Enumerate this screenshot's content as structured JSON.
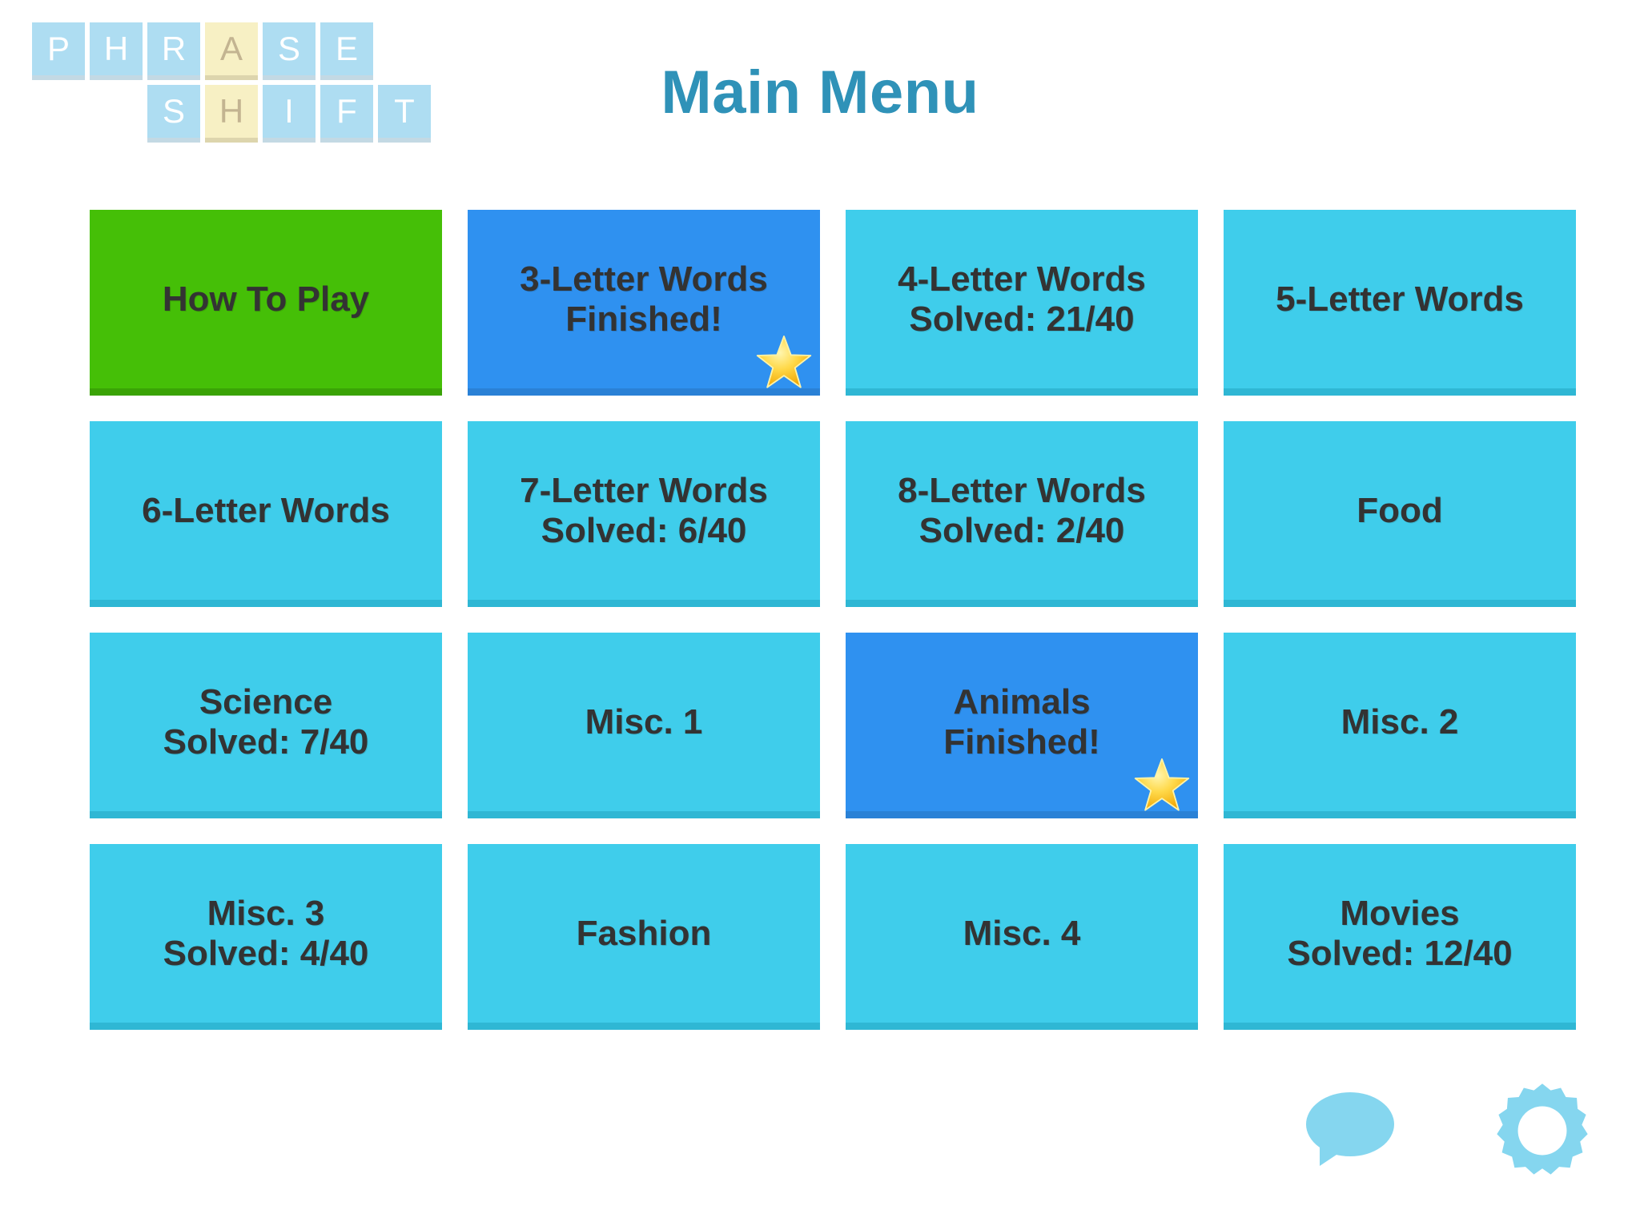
{
  "logo": {
    "name": "Phrase Shift",
    "row1": [
      {
        "letter": "P",
        "color": "blue"
      },
      {
        "letter": "H",
        "color": "blue"
      },
      {
        "letter": "R",
        "color": "blue"
      },
      {
        "letter": "A",
        "color": "yellow"
      },
      {
        "letter": "S",
        "color": "blue"
      },
      {
        "letter": "E",
        "color": "blue"
      }
    ],
    "row2": [
      {
        "letter": "S",
        "color": "blue"
      },
      {
        "letter": "H",
        "color": "yellow"
      },
      {
        "letter": "I",
        "color": "blue"
      },
      {
        "letter": "F",
        "color": "blue"
      },
      {
        "letter": "T",
        "color": "blue"
      }
    ]
  },
  "header": {
    "title": "Main Menu"
  },
  "colors": {
    "title": "#2f92b8",
    "tile_cyan": "#3fcdeb",
    "tile_cyan_shadow": "#2fb7d4",
    "tile_green": "#45bf07",
    "tile_green_shadow": "#3aa306",
    "tile_finished": "#2f91f0",
    "tile_finished_shadow": "#2a81d6",
    "tile_text": "#333333",
    "logo_blue": "#aeddf2",
    "logo_yellow": "#f7f0c4",
    "logo_yellow_text": "#c3b491",
    "bottom_icons": "#85d6ef",
    "star": "#ffcc22"
  },
  "tiles": [
    {
      "name": "how-to-play",
      "label": "How To Play",
      "sub": "",
      "style": "green",
      "star": false
    },
    {
      "name": "3-letter-words",
      "label": "3-Letter Words",
      "sub": "Finished!",
      "style": "done",
      "star": true
    },
    {
      "name": "4-letter-words",
      "label": "4-Letter Words",
      "sub": "Solved: 21/40",
      "style": "cyan",
      "star": false
    },
    {
      "name": "5-letter-words",
      "label": "5-Letter Words",
      "sub": "",
      "style": "cyan",
      "star": false
    },
    {
      "name": "6-letter-words",
      "label": "6-Letter Words",
      "sub": "",
      "style": "cyan",
      "star": false
    },
    {
      "name": "7-letter-words",
      "label": "7-Letter Words",
      "sub": "Solved: 6/40",
      "style": "cyan",
      "star": false
    },
    {
      "name": "8-letter-words",
      "label": "8-Letter Words",
      "sub": "Solved: 2/40",
      "style": "cyan",
      "star": false
    },
    {
      "name": "food",
      "label": "Food",
      "sub": "",
      "style": "cyan",
      "star": false
    },
    {
      "name": "science",
      "label": "Science",
      "sub": "Solved: 7/40",
      "style": "cyan",
      "star": false
    },
    {
      "name": "misc-1",
      "label": "Misc. 1",
      "sub": "",
      "style": "cyan",
      "star": false
    },
    {
      "name": "animals",
      "label": "Animals",
      "sub": "Finished!",
      "style": "done",
      "star": true
    },
    {
      "name": "misc-2",
      "label": "Misc. 2",
      "sub": "",
      "style": "cyan",
      "star": false
    },
    {
      "name": "misc-3",
      "label": "Misc. 3",
      "sub": "Solved: 4/40",
      "style": "cyan",
      "star": false
    },
    {
      "name": "fashion",
      "label": "Fashion",
      "sub": "",
      "style": "cyan",
      "star": false
    },
    {
      "name": "misc-4",
      "label": "Misc. 4",
      "sub": "",
      "style": "cyan",
      "star": false
    },
    {
      "name": "movies",
      "label": "Movies",
      "sub": "Solved: 12/40",
      "style": "cyan",
      "star": false
    }
  ],
  "bottom_icons": [
    {
      "name": "speech-bubble-icon",
      "kind": "speech-bubble"
    },
    {
      "name": "gear-icon",
      "kind": "gear"
    }
  ]
}
